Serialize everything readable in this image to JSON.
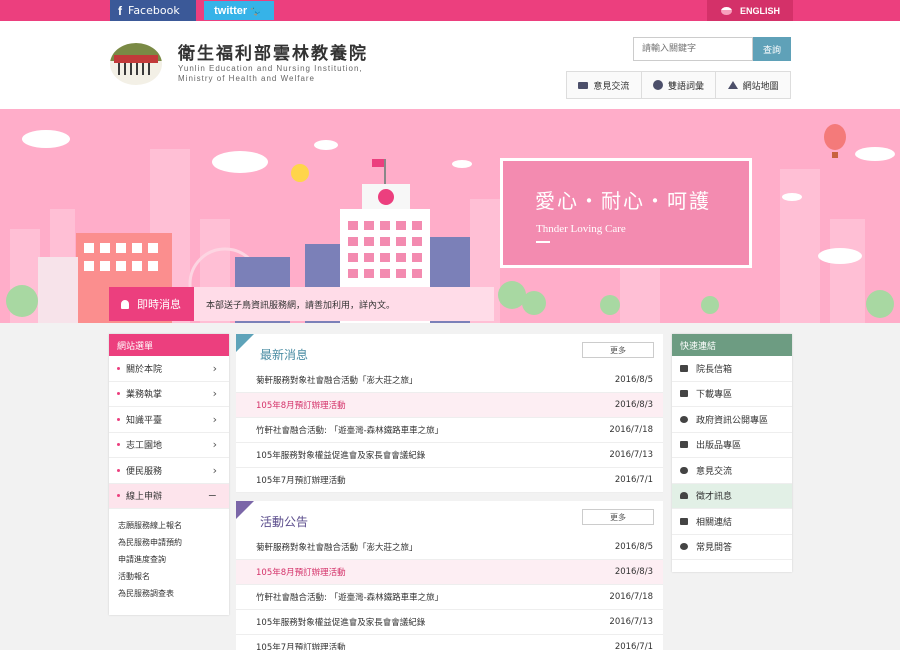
{
  "topbar": {
    "facebook_label": "Facebook",
    "twitter_label": "twitter",
    "english_label": "ENGLISH"
  },
  "header": {
    "title": "衛生福利部雲林教養院",
    "subtitle_line1": "Yunlin Education and Nursing Institution,",
    "subtitle_line2": "Ministry of Health and Welfare",
    "search_placeholder": "請輸入關鍵字",
    "search_button": "查詢",
    "tools": [
      {
        "label": "意見交流",
        "icon": "mail-icon"
      },
      {
        "label": "雙語詞彙",
        "icon": "dictionary-icon"
      },
      {
        "label": "網站地圖",
        "icon": "sitemap-icon"
      }
    ]
  },
  "banner": {
    "slogan": "愛心・耐心・呵護",
    "slogan_en": "Thnder Loving Care",
    "news_label": "即時消息",
    "news_text": "本部送子鳥資訊服務網，請善加利用，詳內文。"
  },
  "sidebar": {
    "title": "網站選單",
    "items": [
      {
        "label": "關於本院",
        "arrow": "›"
      },
      {
        "label": "業務執掌",
        "arrow": "›"
      },
      {
        "label": "知識平臺",
        "arrow": "›"
      },
      {
        "label": "志工園地",
        "arrow": "›"
      },
      {
        "label": "便民服務",
        "arrow": "›"
      },
      {
        "label": "線上申辦",
        "arrow": "−"
      }
    ],
    "sub_items": [
      "志願服務線上報名",
      "為民服務申請預約",
      "申請進度查詢",
      "活動報名",
      "為民服務調查表"
    ]
  },
  "latest_news": {
    "title": "最新消息",
    "more": "更多",
    "rows": [
      {
        "title": "菊軒服務對象社會融合活動「澎大莊之旅」",
        "date": "2016/8/5"
      },
      {
        "title": "105年8月預訂辦理活動",
        "date": "2016/8/3"
      },
      {
        "title": "竹軒社會融合活動: 「遊臺灣-森林鐵路車車之旅」",
        "date": "2016/7/18"
      },
      {
        "title": "105年服務對象權益促進會及家長會會議紀錄",
        "date": "2016/7/13"
      },
      {
        "title": "105年7月預訂辦理活動",
        "date": "2016/7/1"
      }
    ]
  },
  "events": {
    "title": "活動公告",
    "more": "更多",
    "rows": [
      {
        "title": "菊軒服務對象社會融合活動「澎大莊之旅」",
        "date": "2016/8/5"
      },
      {
        "title": "105年8月預訂辦理活動",
        "date": "2016/8/3"
      },
      {
        "title": "竹軒社會融合活動: 「遊臺灣-森林鐵路車車之旅」",
        "date": "2016/7/18"
      },
      {
        "title": "105年服務對象權益促進會及家長會會議紀錄",
        "date": "2016/7/13"
      },
      {
        "title": "105年7月預訂辦理活動",
        "date": "2016/7/1"
      }
    ]
  },
  "quick_links": {
    "title": "快速連結",
    "items": [
      {
        "label": "院長信箱",
        "icon": "mail-icon"
      },
      {
        "label": "下載專區",
        "icon": "download-icon"
      },
      {
        "label": "政府資訊公開專區",
        "icon": "info-icon"
      },
      {
        "label": "出版品專區",
        "icon": "publication-icon"
      },
      {
        "label": "意見交流",
        "icon": "comment-icon"
      },
      {
        "label": "徵才訊息",
        "icon": "user-add-icon"
      },
      {
        "label": "相關連結",
        "icon": "shuffle-icon"
      },
      {
        "label": "常見問答",
        "icon": "question-icon"
      }
    ]
  },
  "colors": {
    "brand_pink": "#ec3f7e",
    "teal": "#5ea3b9",
    "green": "#6d9c82",
    "facebook_blue": "#3b5998",
    "twitter_blue": "#36b3e8"
  }
}
